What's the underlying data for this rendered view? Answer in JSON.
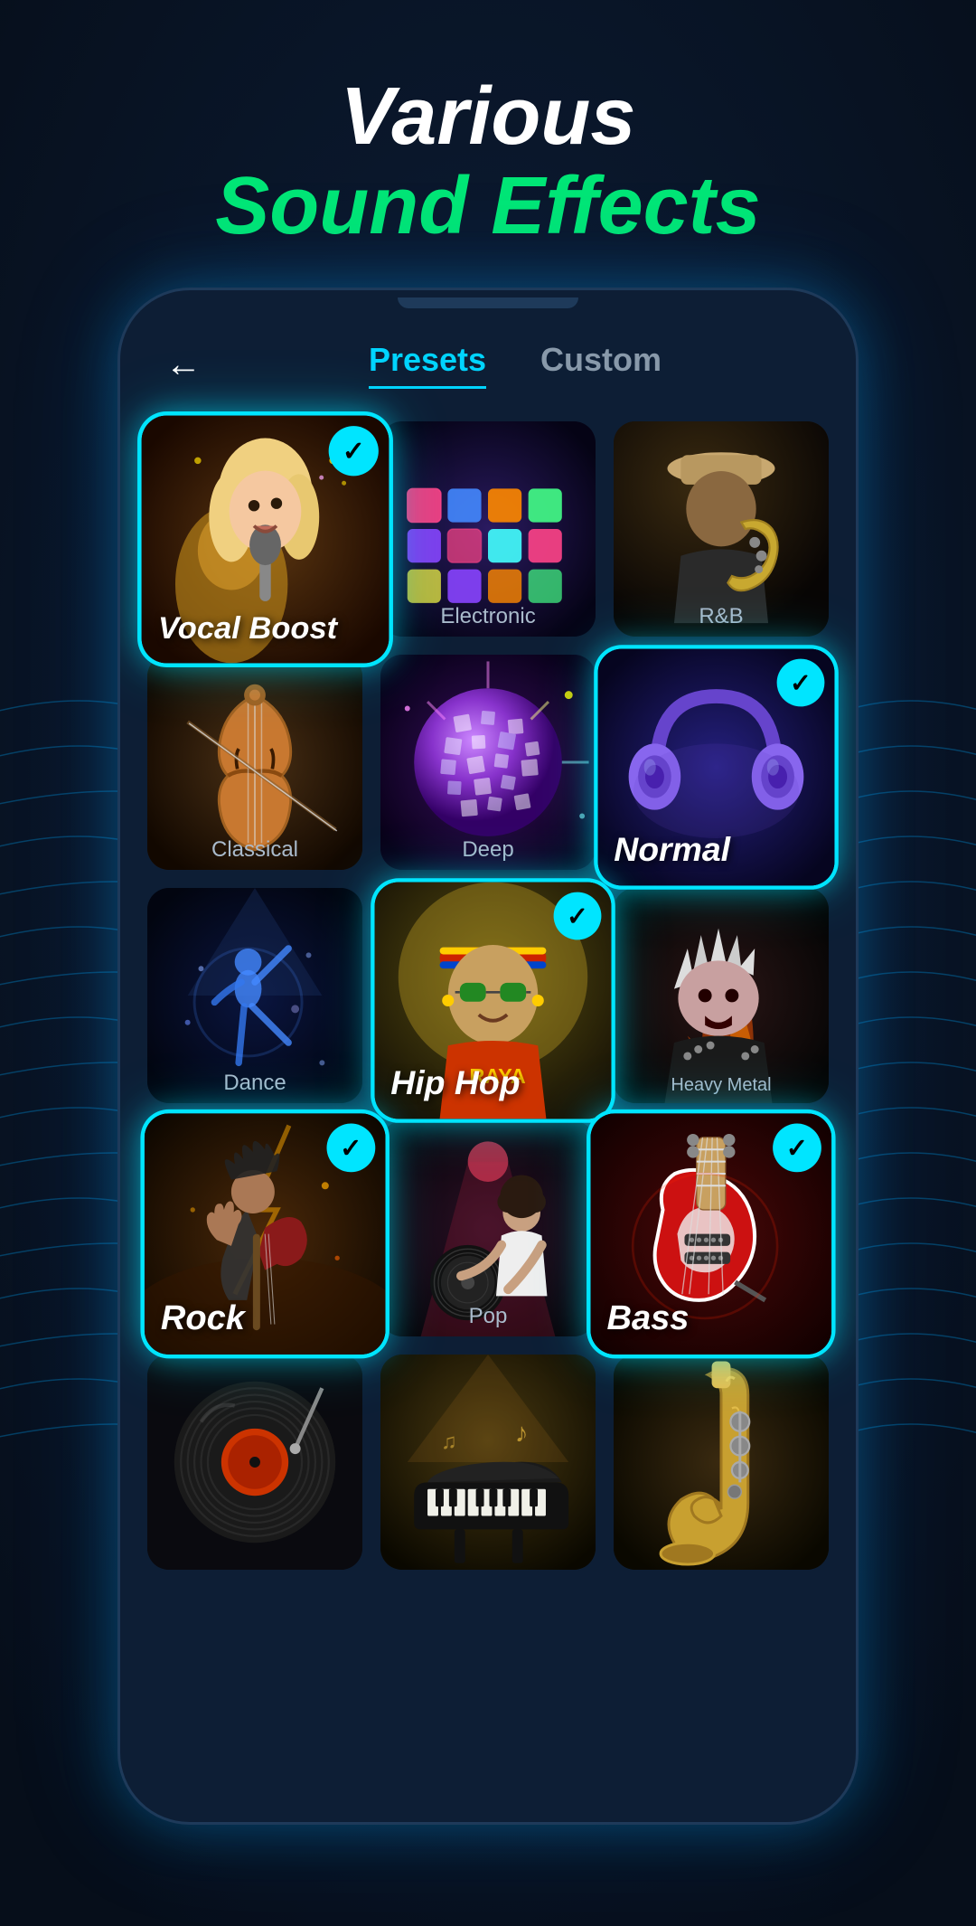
{
  "page": {
    "bg_color": "#091525",
    "header": {
      "title_line1": "Various",
      "title_line2": "Sound Effects"
    },
    "phone": {
      "nav": {
        "back_label": "←",
        "tab_presets": "Presets",
        "tab_custom": "Custom",
        "active_tab": "presets"
      },
      "grid": {
        "cards": [
          {
            "id": "vocal-boost",
            "label": "Vocal Boost",
            "type": "titled",
            "row": 1,
            "col": 1,
            "selected": true,
            "large": true,
            "color_hint": "singer"
          },
          {
            "id": "electronic",
            "label": "Electronic",
            "type": "labeled",
            "row": 1,
            "col": 2,
            "selected": false,
            "color_hint": "djpad"
          },
          {
            "id": "rnb",
            "label": "R&B",
            "type": "labeled",
            "row": 1,
            "col": 3,
            "selected": false,
            "color_hint": "saxophone"
          },
          {
            "id": "classical",
            "label": "Classical",
            "type": "labeled",
            "row": 2,
            "col": 1,
            "selected": false,
            "color_hint": "violin"
          },
          {
            "id": "deep",
            "label": "Deep",
            "type": "labeled",
            "row": 2,
            "col": 2,
            "selected": false,
            "color_hint": "disco"
          },
          {
            "id": "normal",
            "label": "Normal",
            "type": "titled",
            "row": 2,
            "col": 3,
            "selected": true,
            "large": true,
            "color_hint": "headphones"
          },
          {
            "id": "dance",
            "label": "Dance",
            "type": "labeled",
            "row": 3,
            "col": 1,
            "selected": false,
            "color_hint": "dancer"
          },
          {
            "id": "hiphop",
            "label": "Hip Hop",
            "type": "titled",
            "row": 3,
            "col": 2,
            "selected": true,
            "large": true,
            "color_hint": "rapper"
          },
          {
            "id": "heavymetal",
            "label": "Heavy Metal",
            "type": "labeled",
            "row": 3,
            "col": 3,
            "selected": false,
            "color_hint": "guitar"
          },
          {
            "id": "rock",
            "label": "Rock",
            "type": "titled",
            "row": 4,
            "col": 1,
            "selected": true,
            "large": true,
            "color_hint": "rockband"
          },
          {
            "id": "pop",
            "label": "Pop",
            "type": "labeled",
            "row": 4,
            "col": 2,
            "selected": false,
            "color_hint": "dj"
          },
          {
            "id": "bass",
            "label": "Bass",
            "type": "titled",
            "row": 4,
            "col": 3,
            "selected": true,
            "large": true,
            "color_hint": "electricguitar"
          },
          {
            "id": "vinyl",
            "label": "",
            "type": "plain",
            "row": 5,
            "col": 1,
            "selected": false,
            "color_hint": "vinyl"
          },
          {
            "id": "piano",
            "label": "",
            "type": "plain",
            "row": 5,
            "col": 2,
            "selected": false,
            "color_hint": "piano"
          },
          {
            "id": "sax2",
            "label": "",
            "type": "plain",
            "row": 5,
            "col": 3,
            "selected": false,
            "color_hint": "brass"
          }
        ]
      }
    }
  }
}
